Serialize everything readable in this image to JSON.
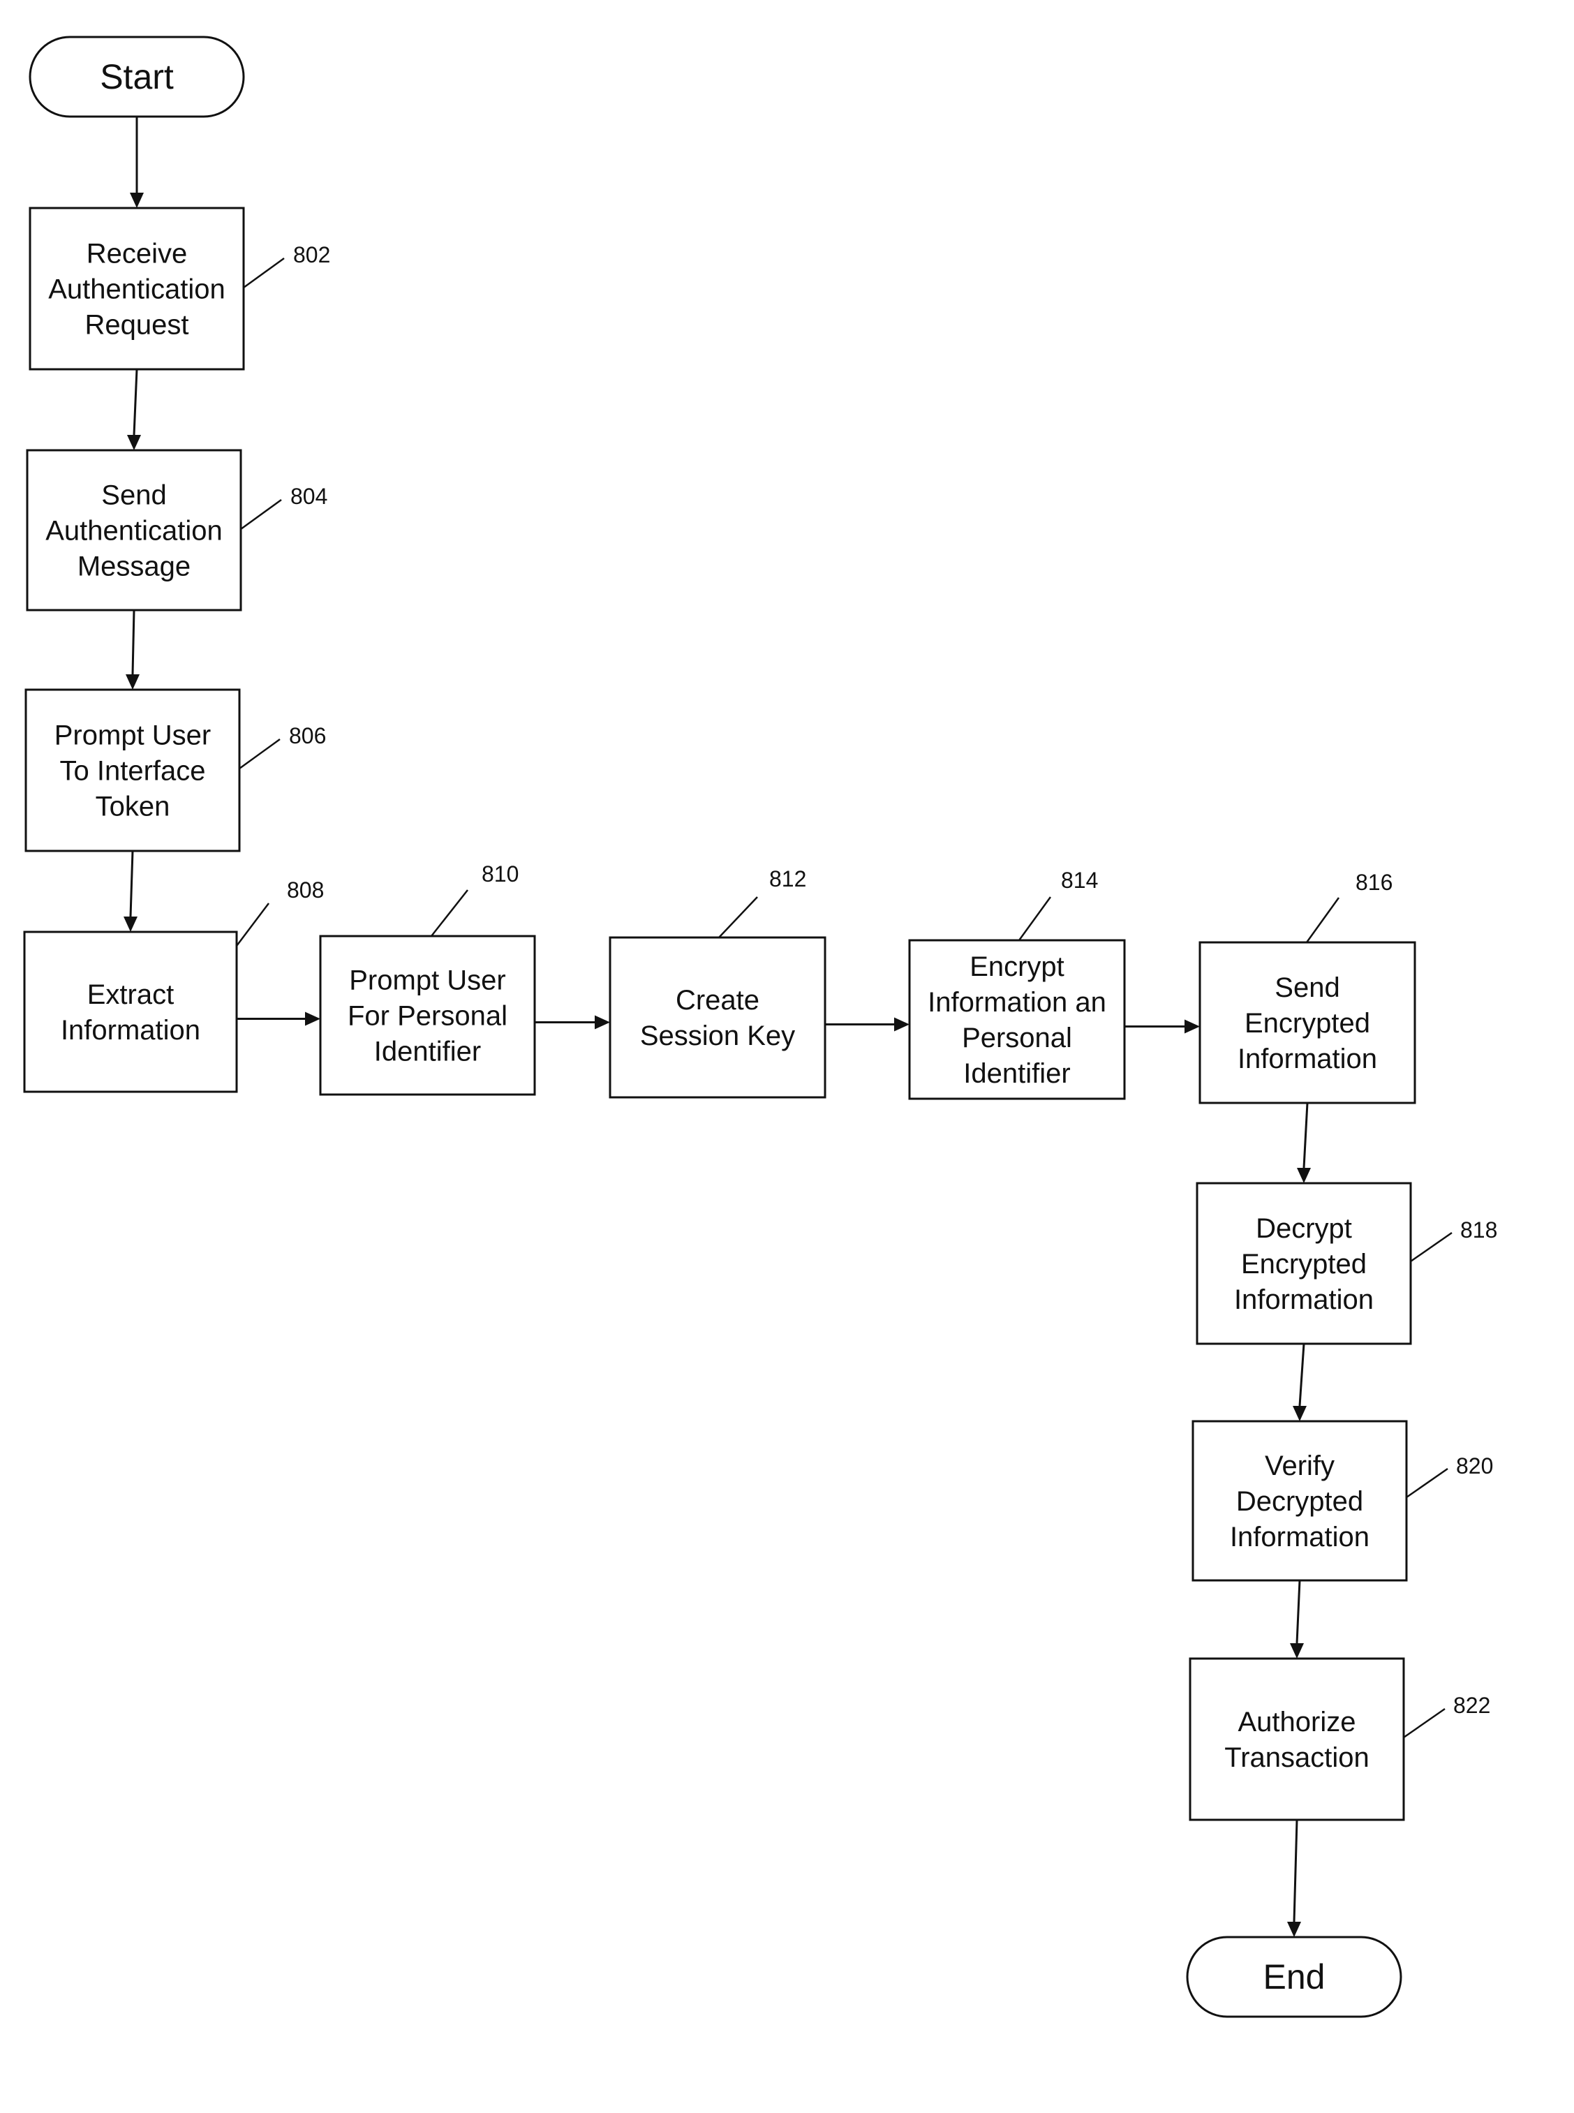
{
  "diagram": {
    "type": "flowchart",
    "nodes": [
      {
        "id": "start",
        "kind": "terminator",
        "lines": [
          "Start"
        ],
        "ref": ""
      },
      {
        "id": "802",
        "kind": "process",
        "lines": [
          "Receive",
          "Authentication",
          "Request"
        ],
        "ref": "802"
      },
      {
        "id": "804",
        "kind": "process",
        "lines": [
          "Send",
          "Authentication",
          "Message"
        ],
        "ref": "804"
      },
      {
        "id": "806",
        "kind": "process",
        "lines": [
          "Prompt User",
          "To Interface",
          "Token"
        ],
        "ref": "806"
      },
      {
        "id": "808",
        "kind": "process",
        "lines": [
          "Extract",
          "Information"
        ],
        "ref": "808"
      },
      {
        "id": "810",
        "kind": "process",
        "lines": [
          "Prompt User",
          "For Personal",
          "Identifier"
        ],
        "ref": "810"
      },
      {
        "id": "812",
        "kind": "process",
        "lines": [
          "Create",
          "Session Key"
        ],
        "ref": "812"
      },
      {
        "id": "814",
        "kind": "process",
        "lines": [
          "Encrypt",
          "Information an",
          "Personal",
          "Identifier"
        ],
        "ref": "814"
      },
      {
        "id": "816",
        "kind": "process",
        "lines": [
          "Send",
          "Encrypted",
          "Information"
        ],
        "ref": "816"
      },
      {
        "id": "818",
        "kind": "process",
        "lines": [
          "Decrypt",
          "Encrypted",
          "Information"
        ],
        "ref": "818"
      },
      {
        "id": "820",
        "kind": "process",
        "lines": [
          "Verify",
          "Decrypted",
          "Information"
        ],
        "ref": "820"
      },
      {
        "id": "822",
        "kind": "process",
        "lines": [
          "Authorize",
          "Transaction"
        ],
        "ref": "822"
      },
      {
        "id": "end",
        "kind": "terminator",
        "lines": [
          "End"
        ],
        "ref": ""
      }
    ],
    "edges": [
      [
        "start",
        "802"
      ],
      [
        "802",
        "804"
      ],
      [
        "804",
        "806"
      ],
      [
        "806",
        "808"
      ],
      [
        "808",
        "810"
      ],
      [
        "810",
        "812"
      ],
      [
        "812",
        "814"
      ],
      [
        "814",
        "816"
      ],
      [
        "816",
        "818"
      ],
      [
        "818",
        "820"
      ],
      [
        "820",
        "822"
      ],
      [
        "822",
        "end"
      ]
    ]
  }
}
